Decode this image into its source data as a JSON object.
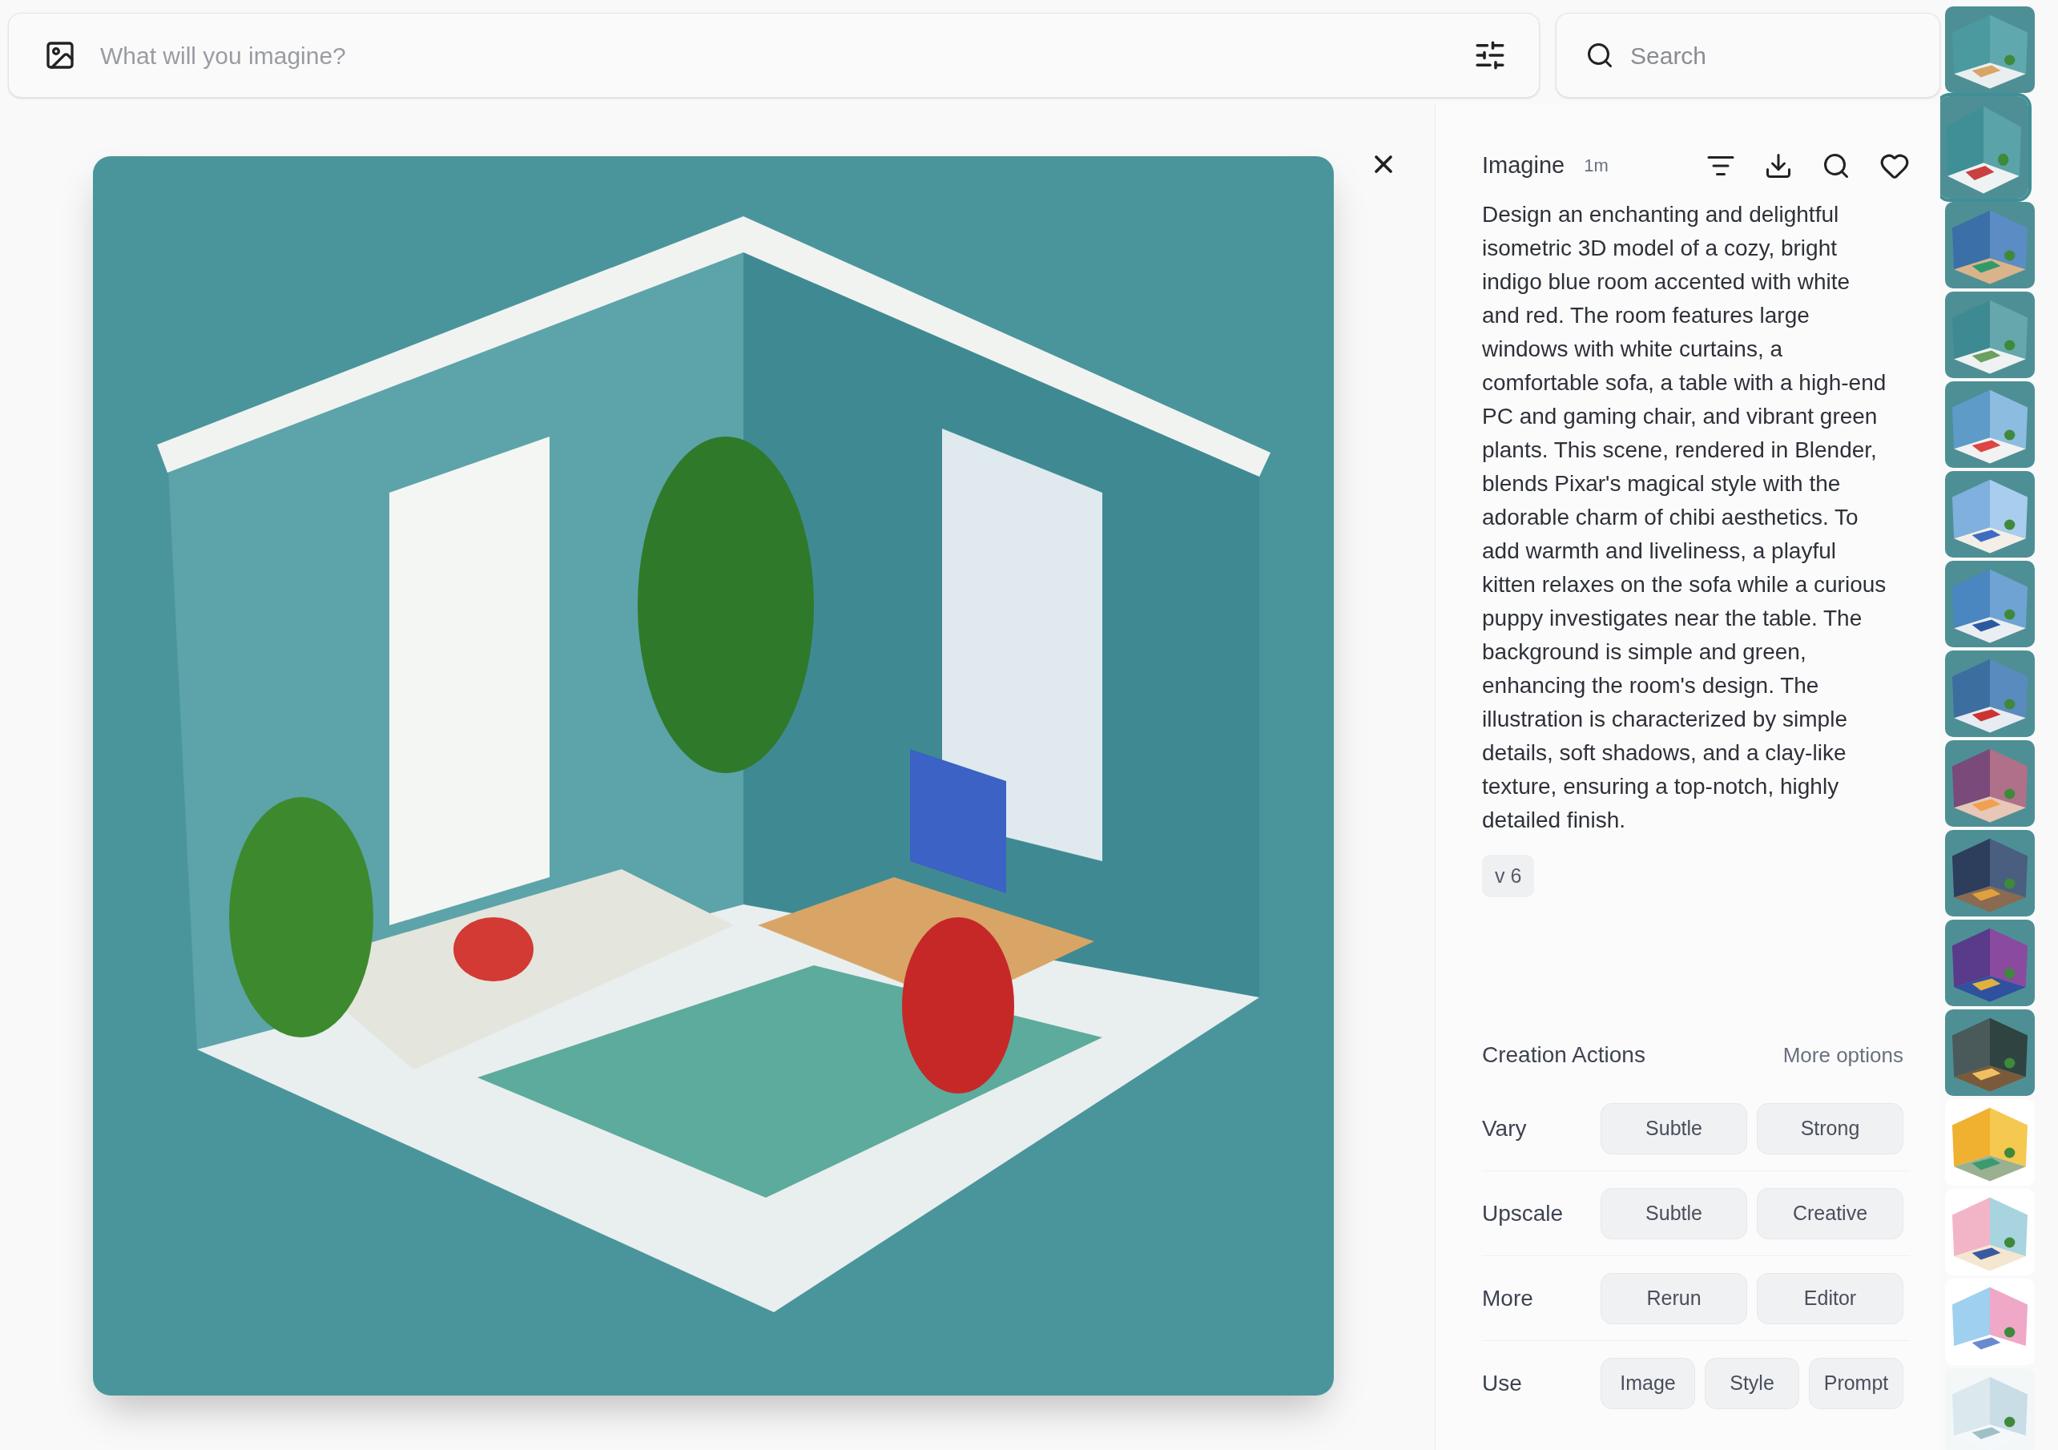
{
  "prompt_bar": {
    "placeholder": "What will you imagine?"
  },
  "search": {
    "placeholder": "Search"
  },
  "details": {
    "title": "Imagine",
    "age": "1m",
    "prompt": "Design an enchanting and delightful isometric 3D model of a cozy, bright indigo blue room accented with white and red. The room features large windows with white curtains, a comfortable sofa, a table with a high-end PC and gaming chair, and vibrant green plants. This scene, rendered in Blender, blends Pixar's magical style with the adorable charm of chibi aesthetics. To add warmth and liveliness, a playful kitten relaxes on the sofa while a curious puppy investigates near the table. The background is simple and green, enhancing the room's design. The illustration is characterized by simple details, soft shadows, and a clay-like texture, ensuring a top-notch, highly detailed finish.",
    "version": "v 6"
  },
  "creation_actions": {
    "title": "Creation Actions",
    "more_link": "More options",
    "rows": [
      {
        "label": "Vary",
        "buttons": [
          "Subtle",
          "Strong"
        ]
      },
      {
        "label": "Upscale",
        "buttons": [
          "Subtle",
          "Creative"
        ]
      },
      {
        "label": "More",
        "buttons": [
          "Rerun",
          "Editor"
        ]
      },
      {
        "label": "Use",
        "buttons": [
          "Image",
          "Style",
          "Prompt"
        ]
      }
    ]
  },
  "thumbnails": [
    {
      "selected": false
    },
    {
      "selected": true
    },
    {
      "selected": false
    },
    {
      "selected": false
    },
    {
      "selected": false
    },
    {
      "selected": false
    },
    {
      "selected": false
    },
    {
      "selected": false
    },
    {
      "selected": false
    },
    {
      "selected": false
    },
    {
      "selected": false
    },
    {
      "selected": false
    },
    {
      "selected": false
    },
    {
      "selected": false
    },
    {
      "selected": false
    },
    {
      "selected": false
    }
  ]
}
